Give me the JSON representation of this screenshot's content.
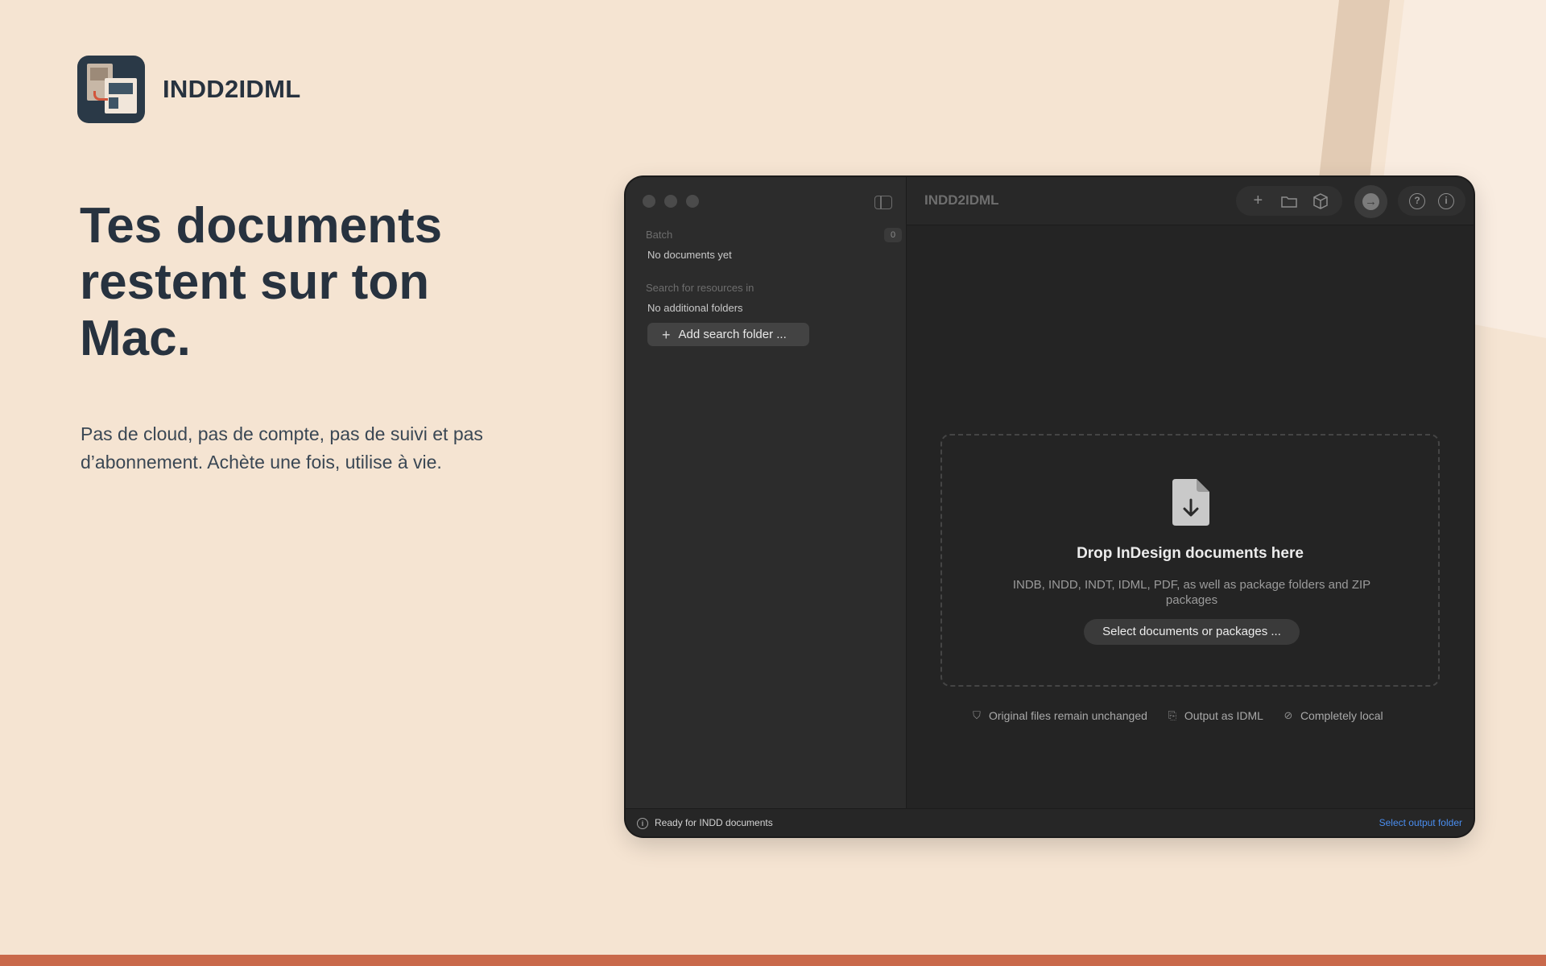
{
  "brand": {
    "name": "INDD2IDML",
    "icon": "indd2idml-app-icon"
  },
  "hero": {
    "headline_line1": "Tes documents",
    "headline_line2": "restent sur ton",
    "headline_line3": "Mac.",
    "subtext": "Pas de cloud, pas de compte, pas de suivi et pas d’abonnement. Achète une fois, utilise à vie."
  },
  "window": {
    "title": "INDD2IDML",
    "sidebar": {
      "batch_label": "Batch",
      "batch_count": "0",
      "batch_empty": "No documents yet",
      "search_label": "Search for resources in",
      "search_empty": "No additional folders",
      "add_folder_label": "Add search folder ..."
    },
    "dropzone": {
      "title": "Drop InDesign documents here",
      "description": "INDB, INDD, INDT, IDML, PDF, as well as package folders and ZIP packages",
      "select_label": "Select documents or packages ..."
    },
    "features": [
      {
        "icon": "shield-icon",
        "label": "Original files remain unchanged"
      },
      {
        "icon": "file-export-icon",
        "label": "Output as IDML"
      },
      {
        "icon": "globe-off-icon",
        "label": "Completely local"
      }
    ],
    "status": {
      "text": "Ready for INDD documents",
      "link": "Select output folder"
    }
  },
  "colors": {
    "background": "#f5e4d2",
    "accent_bar": "#c9694b",
    "headline": "#27323f",
    "link": "#4a8ef0"
  }
}
